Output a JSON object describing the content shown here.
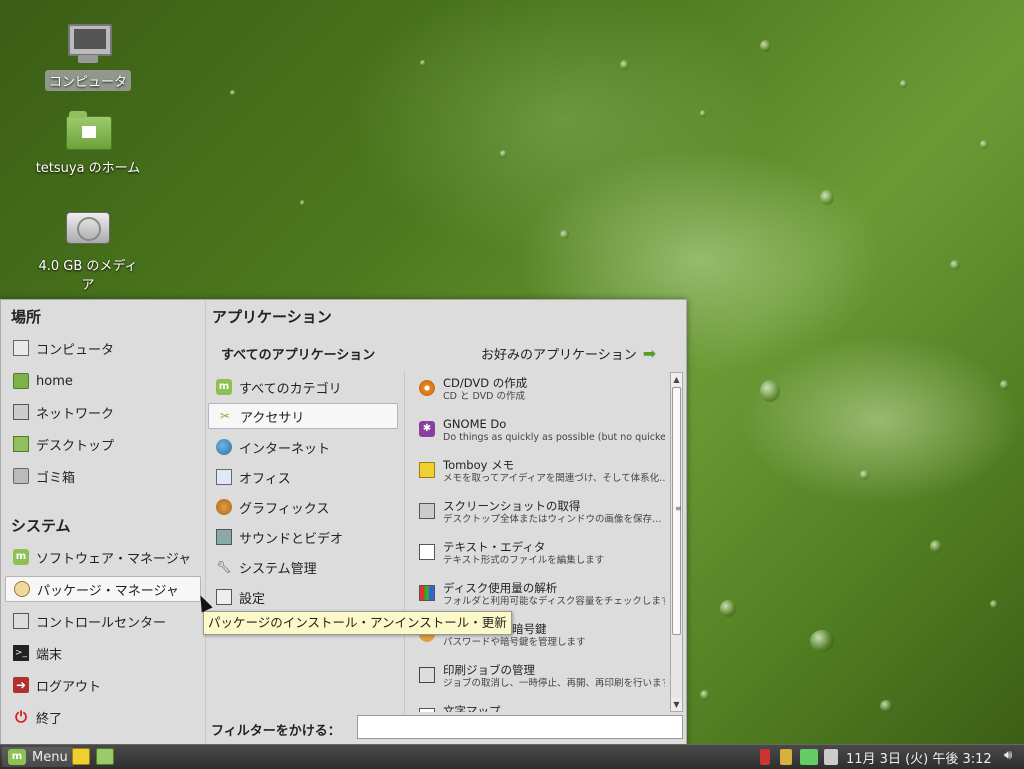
{
  "desktop": {
    "icons": [
      {
        "label": "コンピュータ"
      },
      {
        "label": "tetsuya のホーム"
      },
      {
        "label": "4.0 GB のメディア"
      }
    ]
  },
  "menu": {
    "places_title": "場所",
    "places": [
      {
        "label": "コンピュータ"
      },
      {
        "label": "home"
      },
      {
        "label": "ネットワーク"
      },
      {
        "label": "デスクトップ"
      },
      {
        "label": "ゴミ箱"
      }
    ],
    "system_title": "システム",
    "system": [
      {
        "label": "ソフトウェア・マネージャ"
      },
      {
        "label": "パッケージ・マネージャ"
      },
      {
        "label": "コントロールセンター"
      },
      {
        "label": "端末"
      },
      {
        "label": "ログアウト"
      },
      {
        "label": "終了"
      }
    ],
    "apps_title": "アプリケーション",
    "all_apps_heading": "すべてのアプリケーション",
    "favorites_link": "お好みのアプリケーション",
    "categories": [
      {
        "label": "すべてのカテゴリ"
      },
      {
        "label": "アクセサリ"
      },
      {
        "label": "インターネット"
      },
      {
        "label": "オフィス"
      },
      {
        "label": "グラフィックス"
      },
      {
        "label": "サウンドとビデオ"
      },
      {
        "label": "システム管理"
      },
      {
        "label": "設定"
      }
    ],
    "selected_category": "アクセサリ",
    "apps": [
      {
        "name": "CD/DVD の作成",
        "desc": "CD と DVD の作成"
      },
      {
        "name": "GNOME Do",
        "desc": "Do things as quickly as possible (but no quicker…"
      },
      {
        "name": "Tomboy メモ",
        "desc": "メモを取ってアイディアを関連づけ、そして体系化…"
      },
      {
        "name": "スクリーンショットの取得",
        "desc": "デスクトップ全体またはウィンドウの画像を保存…"
      },
      {
        "name": "テキスト・エディタ",
        "desc": "テキスト形式のファイルを編集します"
      },
      {
        "name": "ディスク使用量の解析",
        "desc": "フォルダと利用可能なディスク容量をチェックします"
      },
      {
        "name": "パスワードと暗号鍵",
        "desc": "パスワードや暗号鍵を管理します"
      },
      {
        "name": "印刷ジョブの管理",
        "desc": "ジョブの取消し、一時停止、再開、再印刷を行います"
      },
      {
        "name": "文字マップ",
        "desc": ""
      }
    ],
    "filter_label": "フィルターをかける：",
    "filter_value": "",
    "tooltip": "パッケージのインストール・アンインストール・更新"
  },
  "taskbar": {
    "menu_label": "Menu",
    "clock": "11月 3日 (火) 午後 3:12"
  }
}
